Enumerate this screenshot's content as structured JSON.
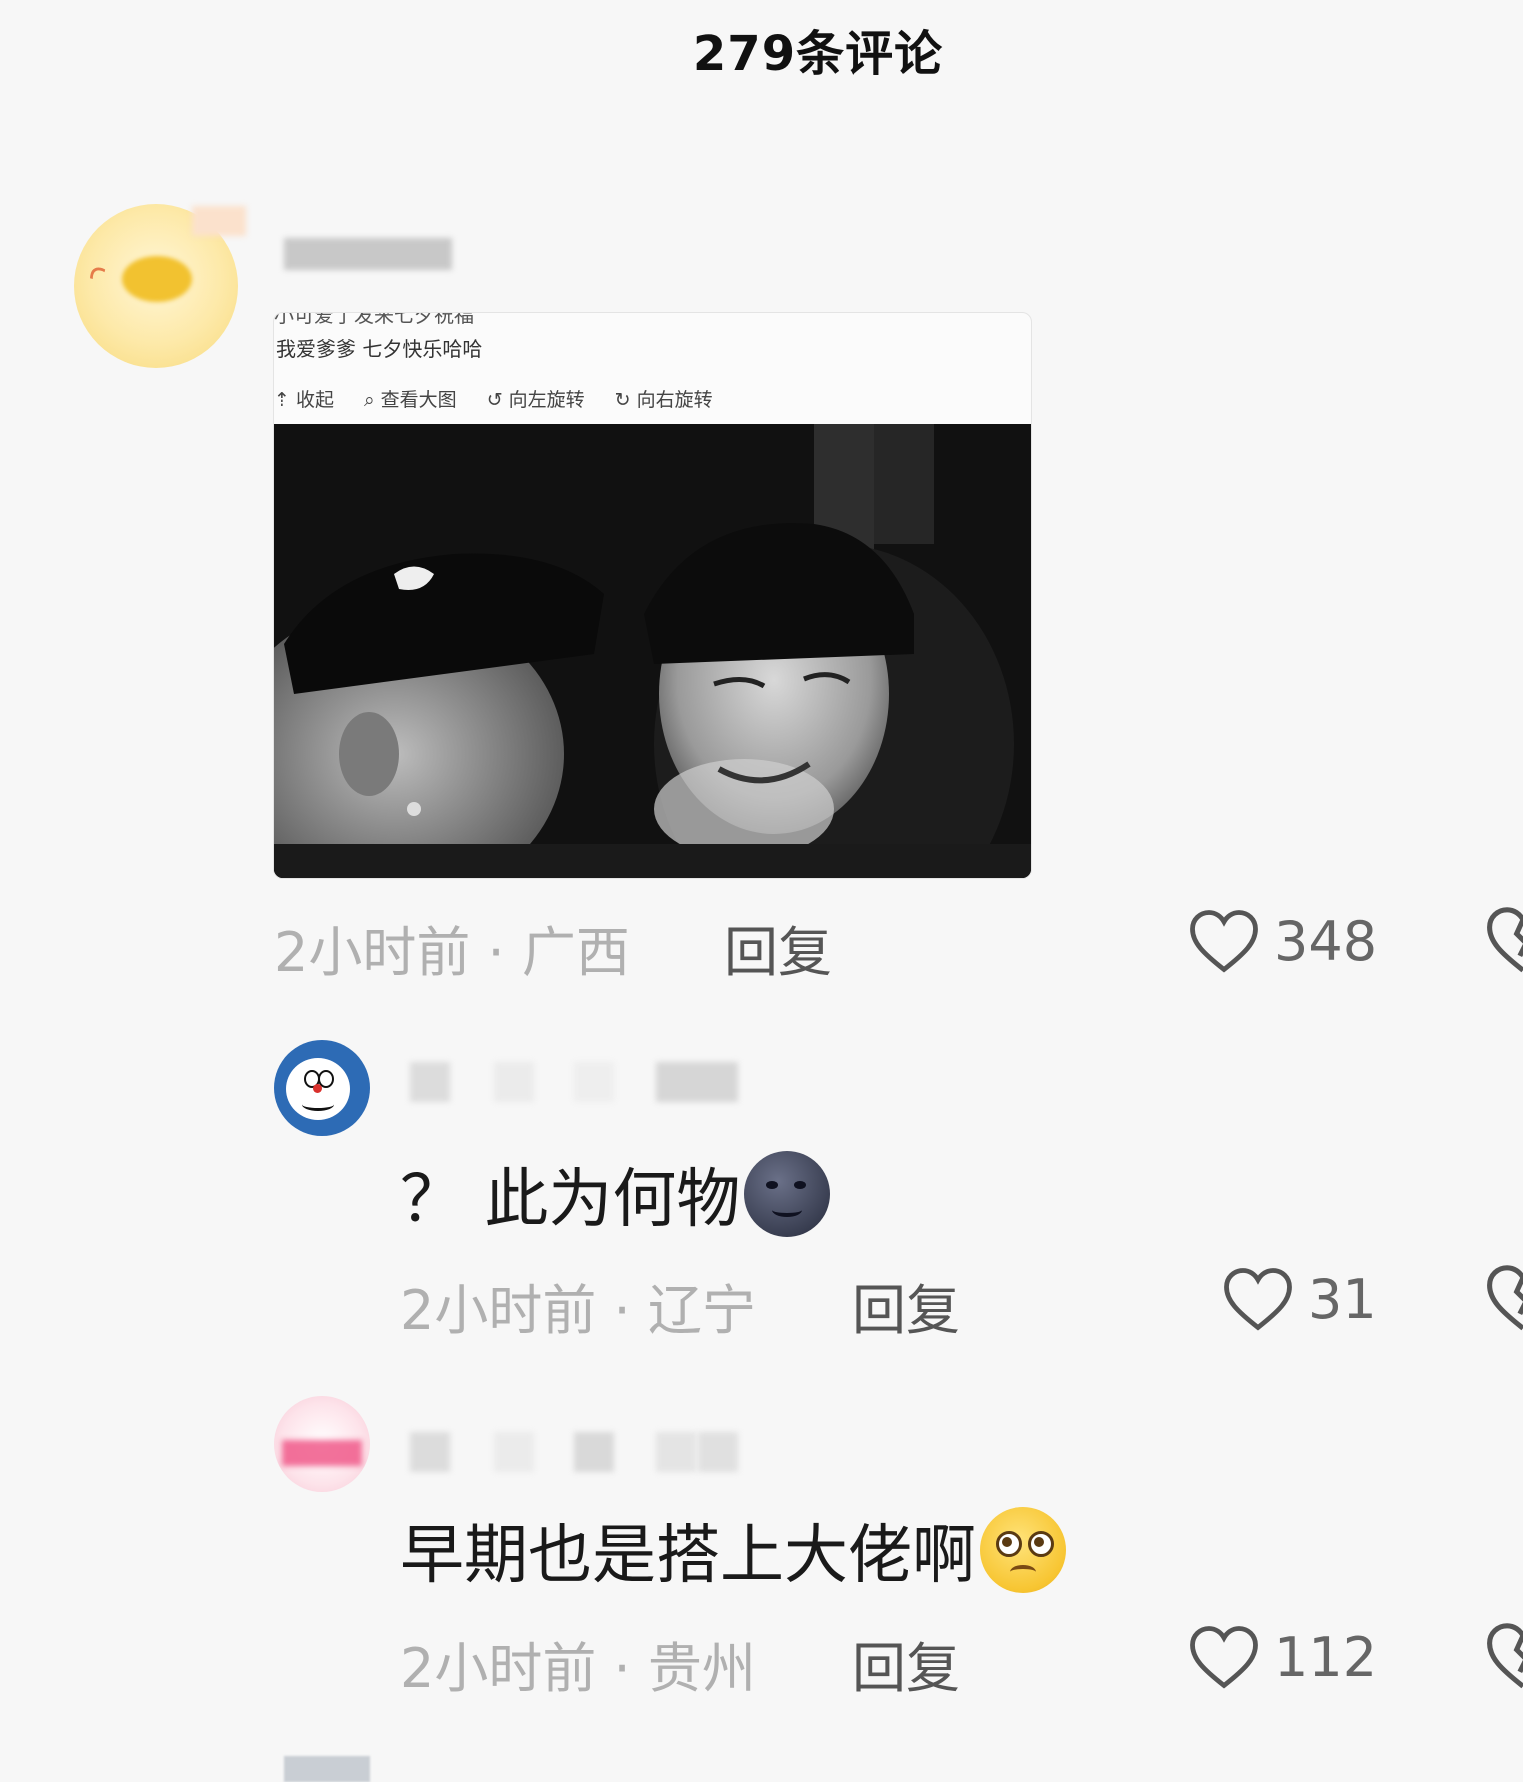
{
  "header": {
    "title": "279条评论"
  },
  "comments": [
    {
      "image": {
        "caption_line": "我爱爹爹 七夕快乐哈哈",
        "toolbar": [
          "收起",
          "查看大图",
          "向左旋转",
          "向右旋转"
        ]
      },
      "time": "2小时前 · 广西",
      "reply_label": "回复",
      "likes": "348"
    },
    {
      "text": "？ 此为何物",
      "emoji": "new-moon-face-emoji",
      "time": "2小时前 · 辽宁",
      "reply_label": "回复",
      "likes": "31"
    },
    {
      "text": "早期也是搭上大佬啊",
      "emoji": "pleading-face-emoji",
      "time": "2小时前 · 贵州",
      "reply_label": "回复",
      "likes": "112"
    }
  ],
  "colors": {
    "background": "#f7f7f7",
    "meta_text": "#b0b0b0",
    "heart": "#555555"
  }
}
